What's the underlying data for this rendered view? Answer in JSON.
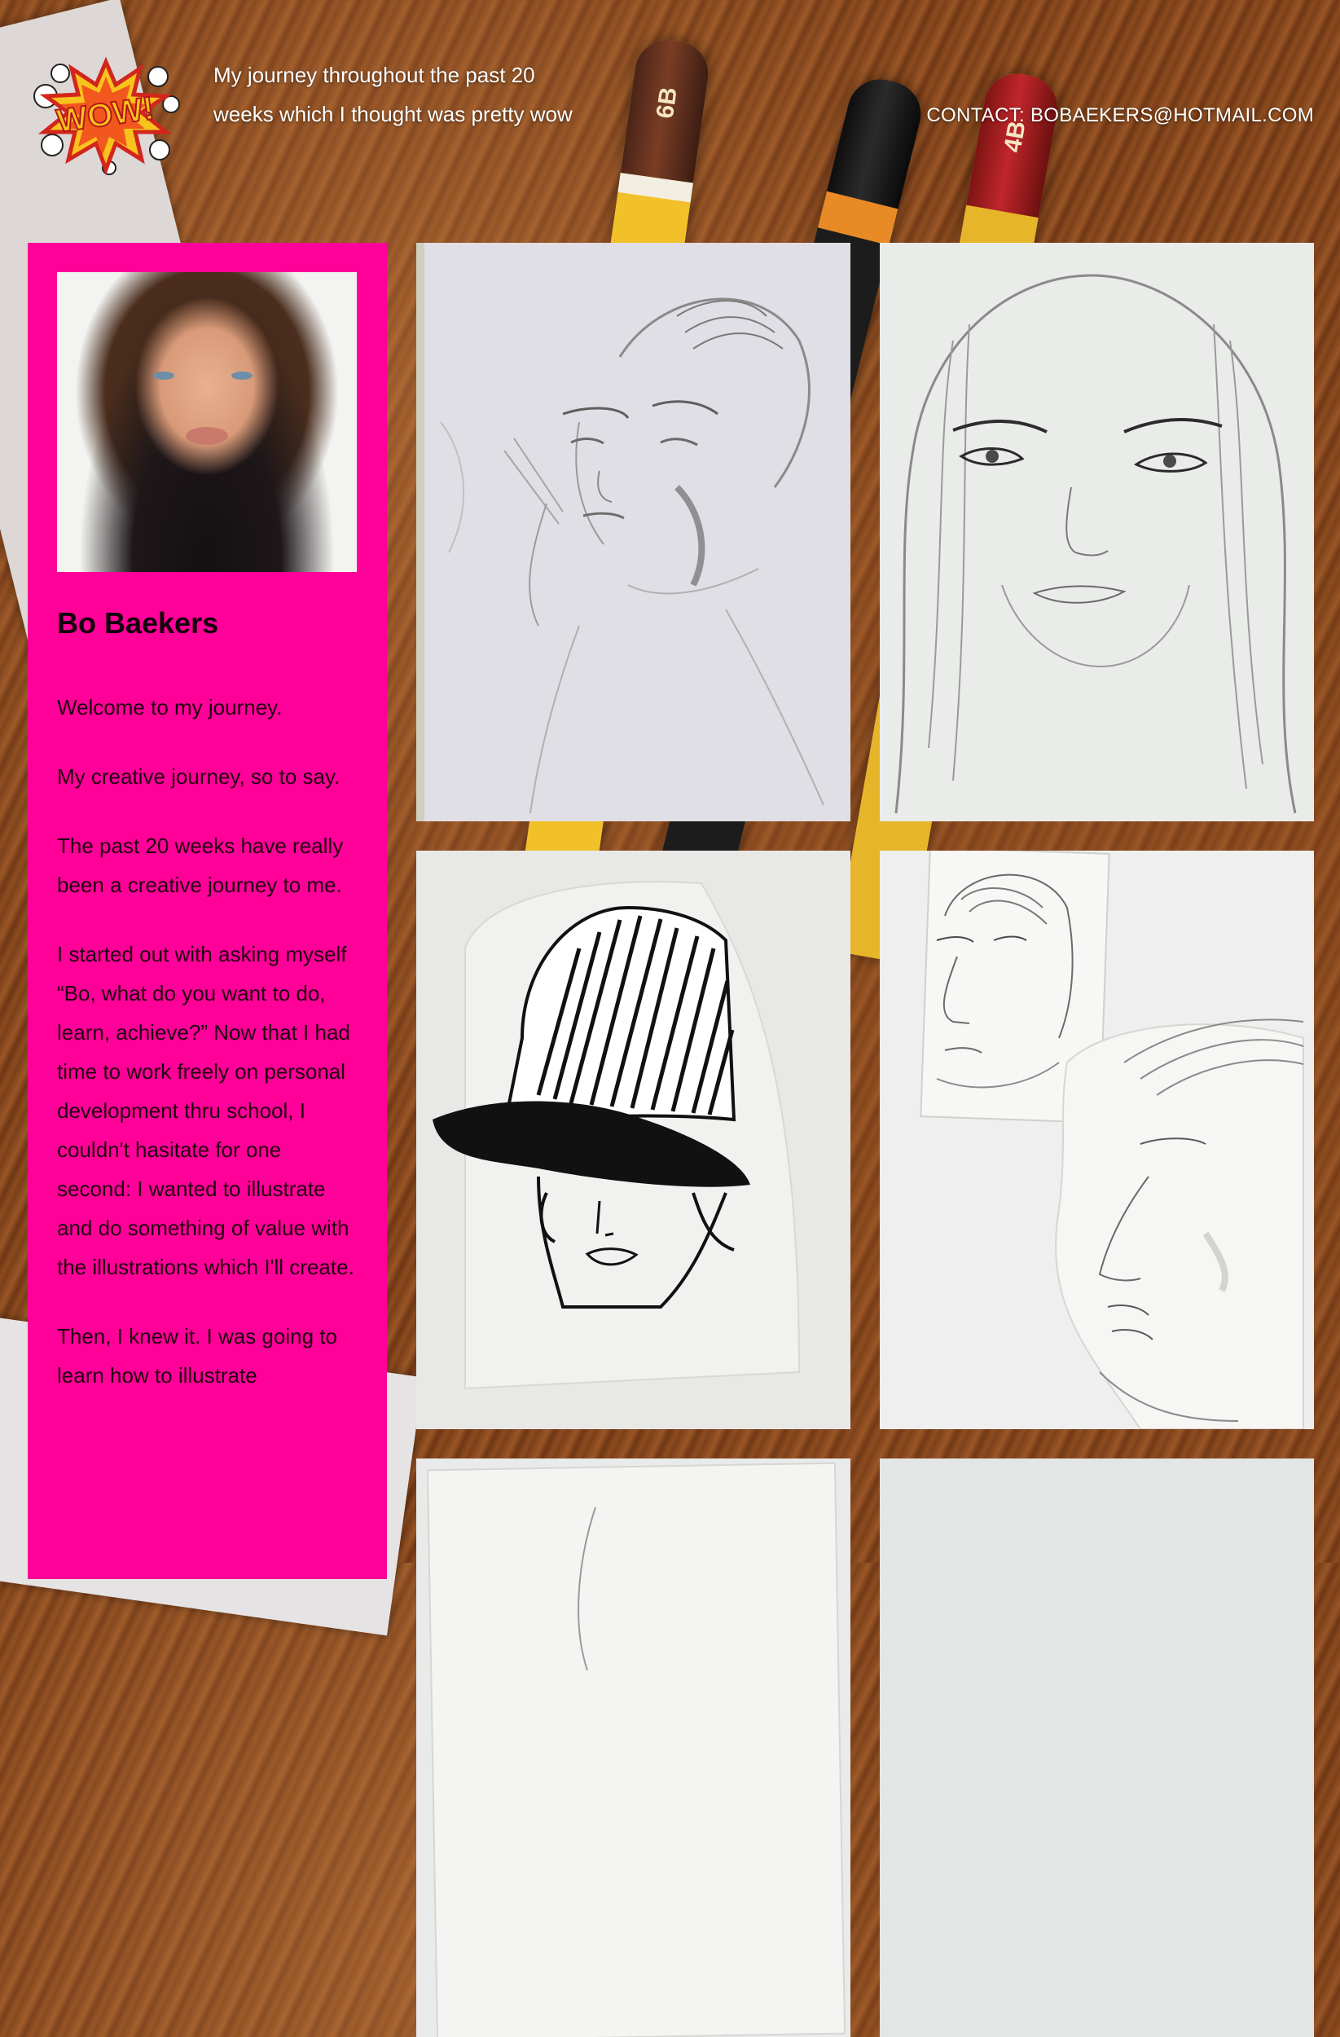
{
  "header": {
    "logo_alt": "WOW comic burst logo",
    "logo_text": "WOW!",
    "tagline": "My journey throughout the past 20 weeks which I thought was pretty wow",
    "contact_label": "CONTACT: BOBAEKERS@HOTMAIL.COM"
  },
  "background": {
    "pencil_labels": [
      "6B",
      "4B"
    ]
  },
  "profile": {
    "name": "Bo Baekers",
    "bio": [
      "Welcome to my journey.",
      "My creative journey, so to say.",
      "The past 20 weeks have really been a creative journey to me.",
      "I started out with asking myself “Bo, what do you want to do, learn, achieve?” Now that I had time to work freely on personal development thru school, I couldn't hasitate for one second: I wanted to illustrate and do something of value with the illustrations which I'll create.",
      "Then, I knew it. I was going to learn how to illustrate"
    ]
  },
  "gallery": {
    "items": [
      {
        "title": "pencil-sketch-smoking-woman"
      },
      {
        "title": "pencil-sketch-woman-portrait"
      },
      {
        "title": "ink-drawing-bucket-hat"
      },
      {
        "title": "pencil-sketch-two-profiles"
      },
      {
        "title": "sketch-partial-5"
      },
      {
        "title": "sketch-partial-6"
      }
    ]
  },
  "colors": {
    "card_background": "#ff0099",
    "header_text": "#ffffff",
    "wood": "#7a3f18"
  }
}
